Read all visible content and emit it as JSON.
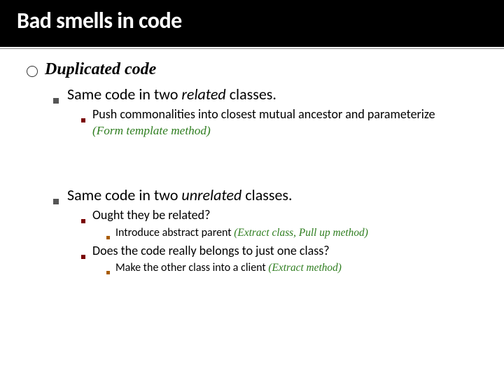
{
  "title": "Bad smells in code",
  "heading": "Duplicated code",
  "section1": {
    "headline_pre": "Same code in two ",
    "headline_em": "related",
    "headline_post": " classes.",
    "point1_line1": "Push commonalities into closest mutual ancestor and parameterize",
    "point1_refactor": "(Form template method)"
  },
  "section2": {
    "headline_pre": "Same code in two ",
    "headline_em": "unrelated",
    "headline_post": " classes.",
    "point1": "Ought they be related?",
    "point1_sub": "Introduce abstract parent ",
    "point1_sub_refactor": "(Extract class, Pull up method)",
    "point2": "Does the code really belongs to just one class?",
    "point2_sub": "Make the other class into a client ",
    "point2_sub_refactor": "(Extract method)"
  }
}
